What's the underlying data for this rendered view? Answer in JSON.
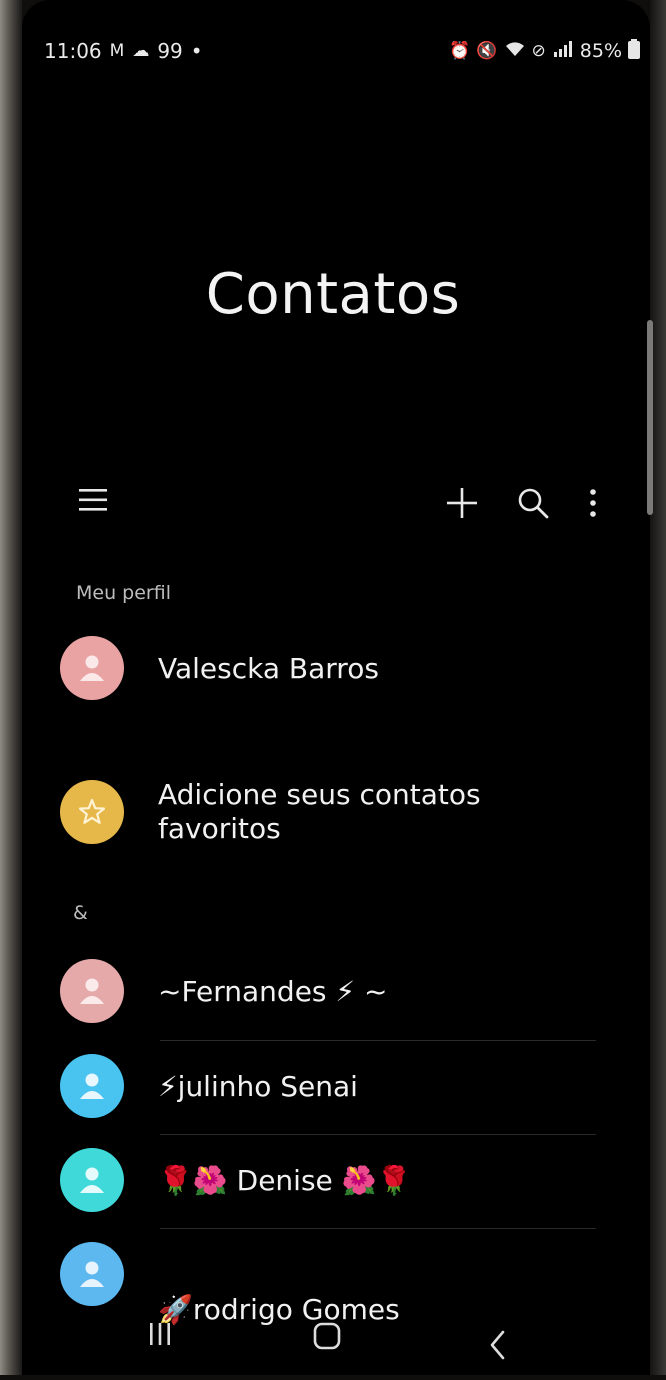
{
  "status_bar": {
    "time": "11:06",
    "notifications": "M",
    "temperature": "99",
    "dot": "•",
    "battery": "85%"
  },
  "header": {
    "title": "Contatos"
  },
  "toolbar": {
    "menu_icon": "hamburger-menu-icon",
    "add_icon": "plus-icon",
    "search_icon": "search-icon",
    "more_icon": "more-vertical-icon"
  },
  "sections": {
    "profile_label": "Meu perfil",
    "ampersand_label": "&"
  },
  "profile": {
    "name": "Valescka Barros",
    "avatar_color": "#e9a3a3"
  },
  "favorites": {
    "label": "Adicione seus contatos favoritos",
    "avatar_color": "#e6b84a"
  },
  "contacts": [
    {
      "name": "~Fernandes ⚡ ~",
      "avatar_color": "#e5a9a9"
    },
    {
      "name": "⚡julinho Senai",
      "avatar_color": "#49c3ef"
    },
    {
      "name": "🌹🌺 Denise 🌺🌹",
      "avatar_color": "#3fd9d9"
    },
    {
      "name": "🚀rodrigo Gomes",
      "avatar_color": "#5db8f0"
    }
  ],
  "nav_bar": {
    "recents_icon": "recents-icon",
    "home_icon": "home-icon",
    "back_icon": "back-icon"
  }
}
